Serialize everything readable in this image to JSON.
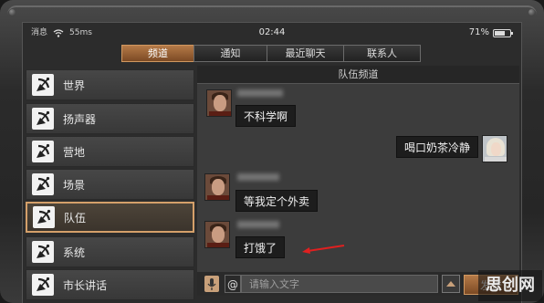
{
  "statusbar": {
    "carrier": "消息",
    "latency": "55ms",
    "time": "02:44",
    "battery_percent": "71%",
    "battery_level": 0.71
  },
  "tabs": [
    {
      "label": "频道",
      "active": true
    },
    {
      "label": "通知",
      "active": false
    },
    {
      "label": "最近聊天",
      "active": false
    },
    {
      "label": "联系人",
      "active": false
    }
  ],
  "sidebar": {
    "items": [
      {
        "label": "世界",
        "icon": "satellite-dish-icon"
      },
      {
        "label": "扬声器",
        "icon": "satellite-dish-icon"
      },
      {
        "label": "营地",
        "icon": "satellite-dish-icon"
      },
      {
        "label": "场景",
        "icon": "satellite-dish-icon"
      },
      {
        "label": "队伍",
        "icon": "satellite-dish-icon",
        "active": true
      },
      {
        "label": "系统",
        "icon": "satellite-dish-icon"
      },
      {
        "label": "市长讲话",
        "icon": "satellite-dish-icon"
      }
    ]
  },
  "chat": {
    "title": "队伍频道",
    "messages": [
      {
        "text": "不科学啊",
        "side": "left"
      },
      {
        "text": "喝口奶茶冷静",
        "side": "right"
      },
      {
        "text": "等我定个外卖",
        "side": "left"
      },
      {
        "text": "打饿了",
        "side": "left"
      }
    ]
  },
  "input": {
    "placeholder": "请输入文字",
    "at_label": "@",
    "send_label": "发送"
  },
  "watermark": "思创网",
  "colors": {
    "accent": "#b57a48",
    "active_border": "#d5a06a",
    "arrow": "#e02020"
  }
}
